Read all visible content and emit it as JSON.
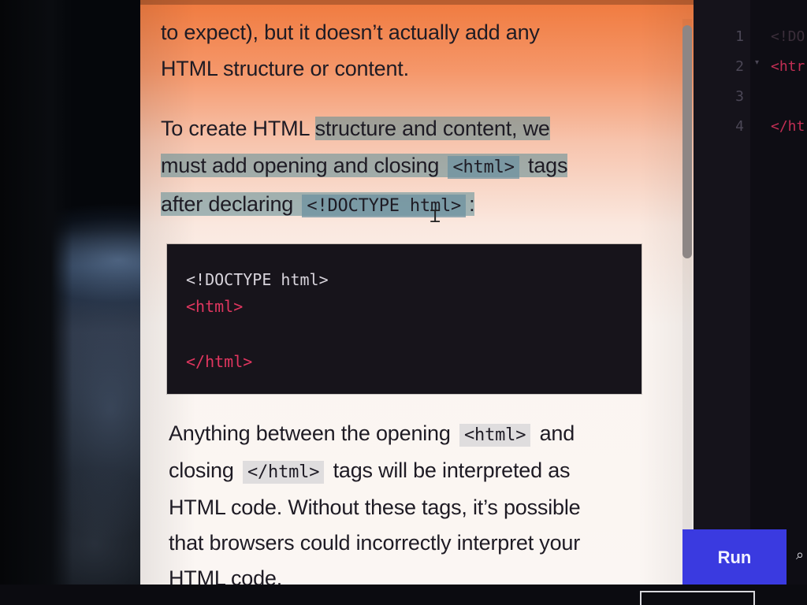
{
  "lesson": {
    "paragraph1": {
      "line1": "to expect), but it doesn’t actually add any",
      "line2": "HTML structure or content."
    },
    "paragraph2": {
      "segment1": "To create HTML ",
      "segment2": "structure and content, we",
      "segment3": "must add opening and closing ",
      "code1": "<html>",
      "segment4": " tags",
      "segment5": "after declaring ",
      "code2": "<!DOCTYPE html>",
      "segment6": ":"
    },
    "code_block": {
      "line1": "<!DOCTYPE html>",
      "line2": "<html>",
      "line3": "</html>"
    },
    "paragraph3": {
      "segment1": "Anything between the opening ",
      "code1": "<html>",
      "segment2": " and",
      "segment3": "closing ",
      "code2": "</html>",
      "segment4": " tags will be interpreted as",
      "line3": "HTML code. Without these tags, it’s possible",
      "line4": "that browsers could incorrectly interpret your",
      "line5": "HTML code."
    }
  },
  "editor": {
    "lines": [
      {
        "number": "1",
        "code": "<!DO"
      },
      {
        "number": "2",
        "code": "<htr"
      },
      {
        "number": "3",
        "code": ""
      },
      {
        "number": "4",
        "code": "</ht"
      }
    ]
  },
  "run_button": {
    "label": "Run"
  },
  "colors": {
    "code_tag": "#e0365f",
    "code_bg": "#17141b",
    "run_button_bg": "#3a3ae0",
    "highlight": "#5a8c96"
  }
}
